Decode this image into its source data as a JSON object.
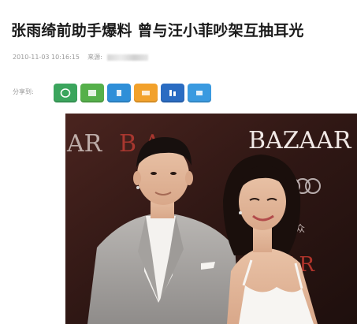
{
  "article": {
    "title": "张雨绮前助手爆料 曾与汪小菲吵架互抽耳光",
    "timestamp": "2010-11-03 10:16:15",
    "source_label": "来源:"
  },
  "share": {
    "label": "分享到:",
    "buttons": [
      {
        "name": "wechat",
        "color": "#3ba55d",
        "icon": "wechat-icon"
      },
      {
        "name": "moments",
        "color": "#55b04a",
        "icon": "moments-icon"
      },
      {
        "name": "qzone",
        "color": "#2f8fd8",
        "icon": "qzone-icon"
      },
      {
        "name": "weibo",
        "color": "#f2a12b",
        "icon": "weibo-icon"
      },
      {
        "name": "renren",
        "color": "#2a6cc2",
        "icon": "renren-icon"
      },
      {
        "name": "more",
        "color": "#3a9ae0",
        "icon": "more-icon"
      }
    ]
  },
  "photo": {
    "backdrop_texts": [
      "BAZAAR",
      "AR",
      "B A",
      "AZAAR",
      "大众"
    ]
  }
}
